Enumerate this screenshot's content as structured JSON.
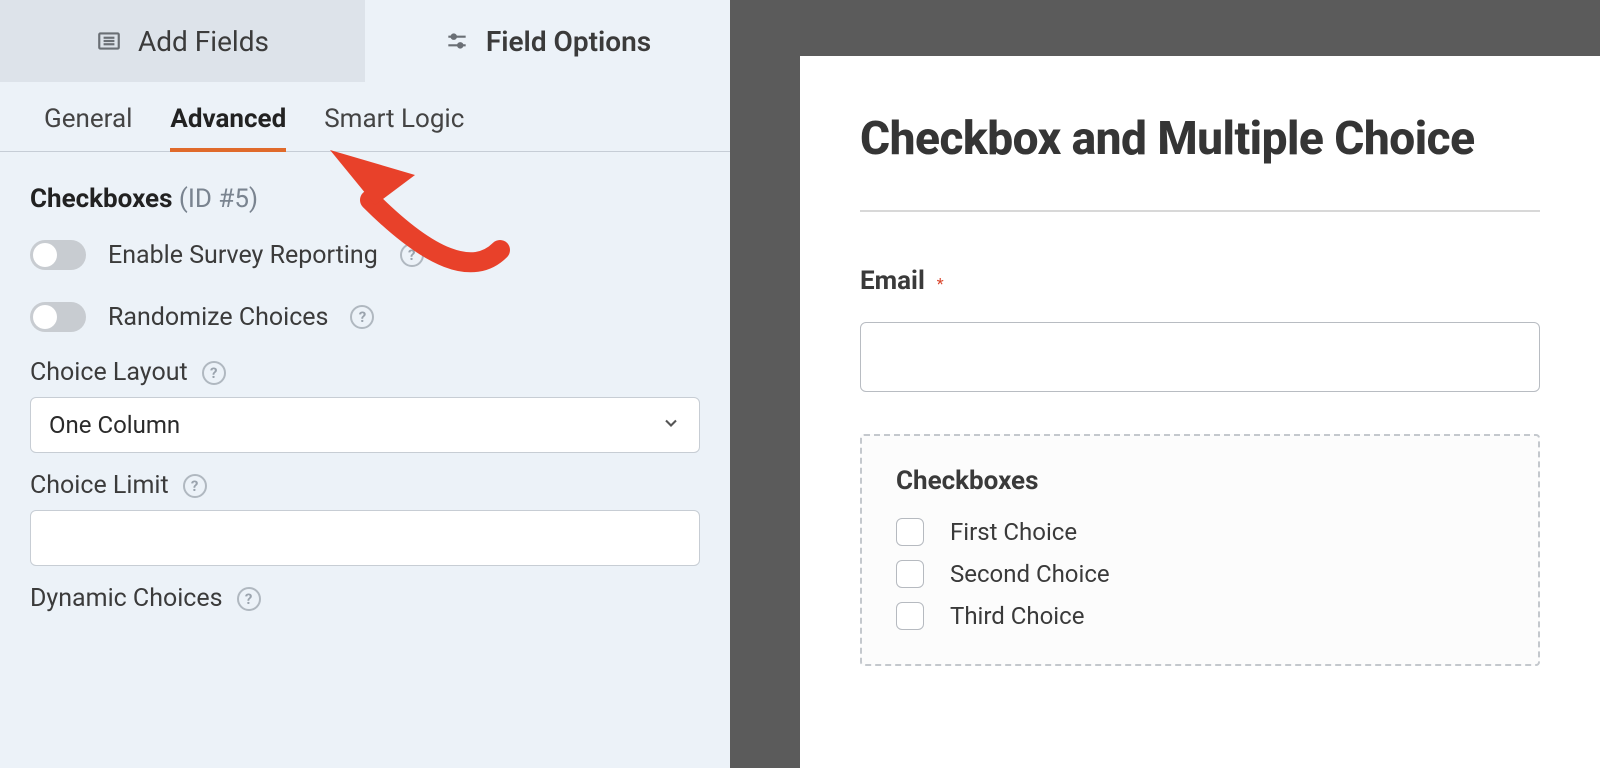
{
  "mainTabs": {
    "addFields": "Add Fields",
    "fieldOptions": "Field Options"
  },
  "subTabs": {
    "general": "General",
    "advanced": "Advanced",
    "smartLogic": "Smart Logic"
  },
  "fieldHeader": {
    "name": "Checkboxes",
    "id": "(ID #5)"
  },
  "toggles": {
    "surveyReporting": "Enable Survey Reporting",
    "randomize": "Randomize Choices"
  },
  "choiceLayout": {
    "label": "Choice Layout",
    "value": "One Column"
  },
  "choiceLimit": {
    "label": "Choice Limit"
  },
  "dynamicChoices": {
    "label": "Dynamic Choices"
  },
  "preview": {
    "title": "Checkbox and Multiple Choice",
    "emailLabel": "Email",
    "checkboxesLabel": "Checkboxes",
    "choices": [
      "First Choice",
      "Second Choice",
      "Third Choice"
    ]
  }
}
